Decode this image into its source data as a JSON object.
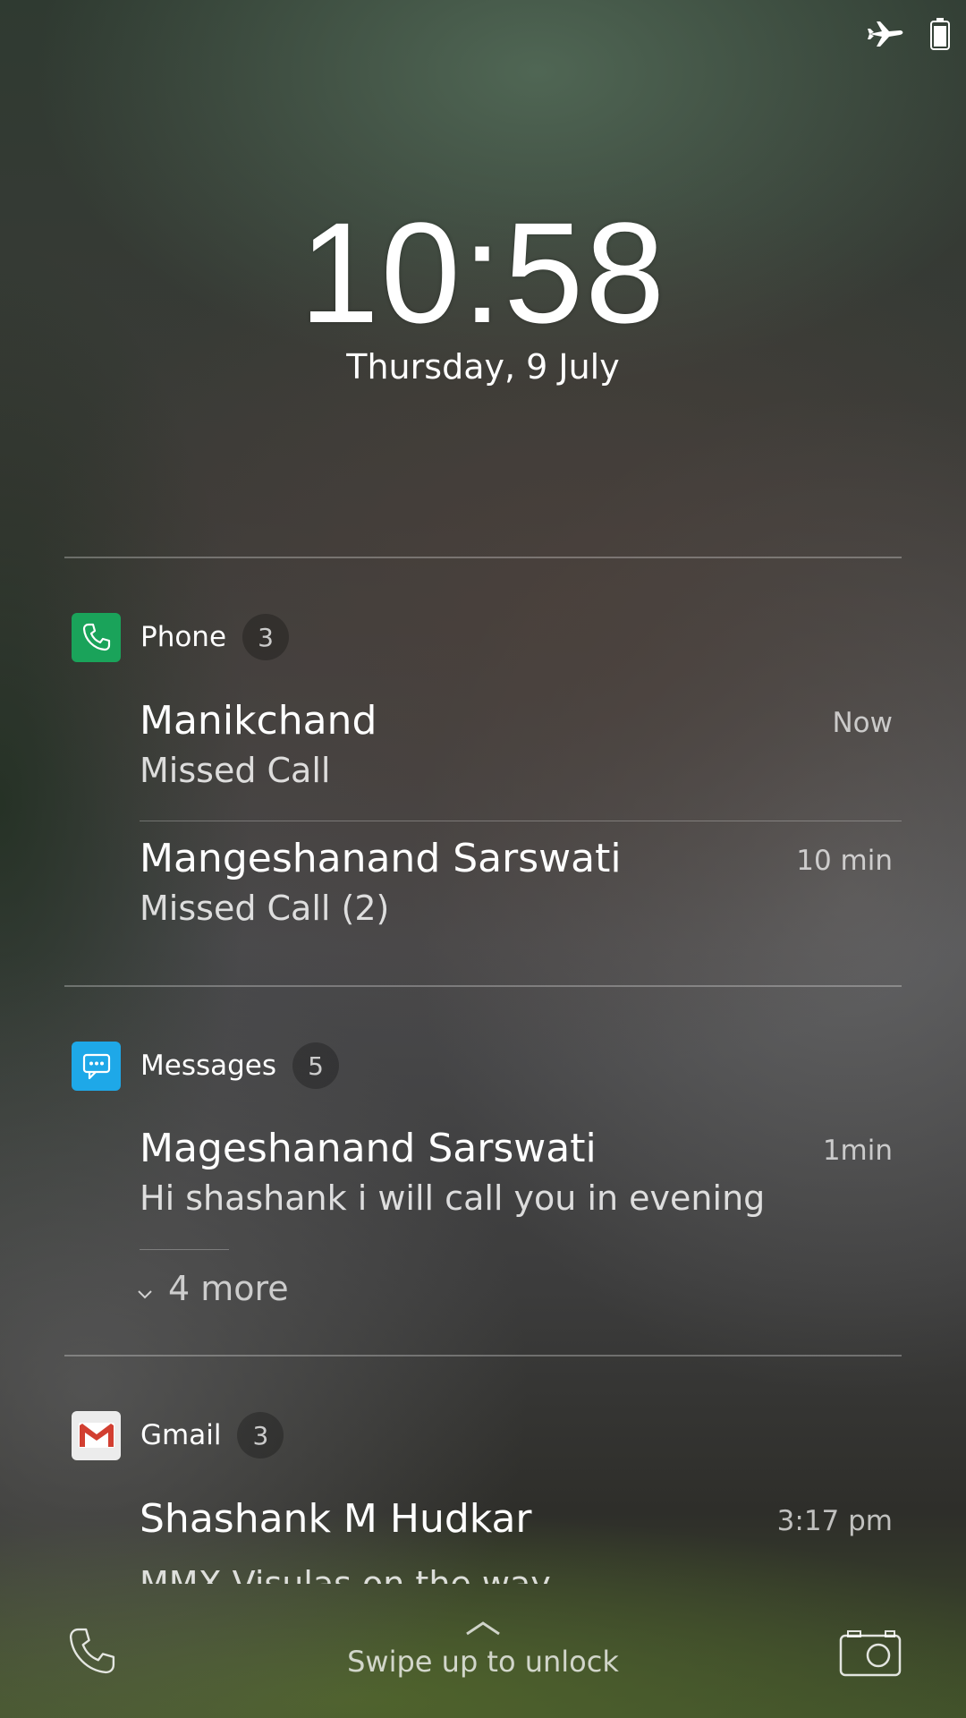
{
  "status_bar": {
    "icons": [
      "airplane-icon",
      "battery-icon"
    ]
  },
  "lockscreen": {
    "time": "10:58",
    "date": "Thursday, 9 July"
  },
  "groups": {
    "phone": {
      "app_name": "Phone",
      "count": "3",
      "accent": "#1aa35a",
      "items": [
        {
          "title": "Manikchand",
          "body": "Missed Call",
          "time": "Now"
        },
        {
          "title": "Mangeshanand Sarswati",
          "body": "Missed Call (2)",
          "time": "10 min"
        }
      ]
    },
    "messages": {
      "app_name": "Messages",
      "count": "5",
      "accent": "#1ea8e8",
      "items": [
        {
          "title": "Mageshanand Sarswati",
          "body": "Hi shashank i will call you in evening",
          "time": "1min"
        }
      ],
      "more_label": "4 more"
    },
    "gmail": {
      "app_name": "Gmail",
      "count": "3",
      "accent": "#d23f31",
      "items": [
        {
          "title": "Shashank M Hudkar",
          "body": "MMX Visulas on the way",
          "time": "3:17 pm"
        }
      ]
    }
  },
  "bottom": {
    "left_icon": "phone-icon",
    "unlock_hint": "Swipe up to unlock",
    "right_icon": "camera-icon"
  }
}
